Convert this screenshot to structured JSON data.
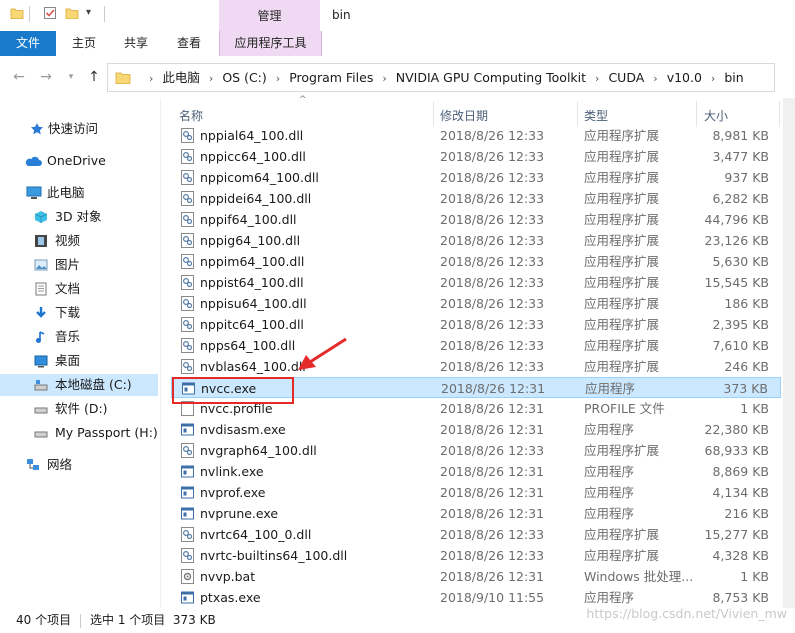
{
  "window": {
    "title": "bin",
    "context_tab_group": "管理"
  },
  "ribbon": {
    "tabs": [
      "文件",
      "主页",
      "共享",
      "查看"
    ],
    "context_tab": "应用程序工具",
    "accent": "#1979ca",
    "context_color": "#f0d9f3"
  },
  "address": {
    "crumbs": [
      "此电脑",
      "OS (C:)",
      "Program Files",
      "NVIDIA GPU Computing Toolkit",
      "CUDA",
      "v10.0",
      "bin"
    ]
  },
  "sidebar": {
    "items": [
      {
        "label": "快速访问",
        "icon": "star-icon"
      },
      {
        "label": "OneDrive",
        "icon": "cloud-icon"
      },
      {
        "label": "此电脑",
        "icon": "computer-icon"
      },
      {
        "label": "3D 对象",
        "icon": "cube-icon"
      },
      {
        "label": "视频",
        "icon": "video-icon"
      },
      {
        "label": "图片",
        "icon": "picture-icon"
      },
      {
        "label": "文档",
        "icon": "document-icon"
      },
      {
        "label": "下载",
        "icon": "download-icon"
      },
      {
        "label": "音乐",
        "icon": "music-icon"
      },
      {
        "label": "桌面",
        "icon": "desktop-icon"
      },
      {
        "label": "本地磁盘 (C:)",
        "icon": "drive-icon"
      },
      {
        "label": "软件 (D:)",
        "icon": "drive-icon"
      },
      {
        "label": "My Passport (H:)",
        "icon": "drive-icon"
      },
      {
        "label": "网络",
        "icon": "network-icon"
      }
    ]
  },
  "columns": {
    "name": "名称",
    "date": "修改日期",
    "type": "类型",
    "size": "大小"
  },
  "files": [
    {
      "name": "nppial64_100.dll",
      "date": "2018/8/26 12:33",
      "type": "应用程序扩展",
      "size": "8,981 KB",
      "kind": "dll"
    },
    {
      "name": "nppicc64_100.dll",
      "date": "2018/8/26 12:33",
      "type": "应用程序扩展",
      "size": "3,477 KB",
      "kind": "dll"
    },
    {
      "name": "nppicom64_100.dll",
      "date": "2018/8/26 12:33",
      "type": "应用程序扩展",
      "size": "937 KB",
      "kind": "dll"
    },
    {
      "name": "nppidei64_100.dll",
      "date": "2018/8/26 12:33",
      "type": "应用程序扩展",
      "size": "6,282 KB",
      "kind": "dll"
    },
    {
      "name": "nppif64_100.dll",
      "date": "2018/8/26 12:33",
      "type": "应用程序扩展",
      "size": "44,796 KB",
      "kind": "dll"
    },
    {
      "name": "nppig64_100.dll",
      "date": "2018/8/26 12:33",
      "type": "应用程序扩展",
      "size": "23,126 KB",
      "kind": "dll"
    },
    {
      "name": "nppim64_100.dll",
      "date": "2018/8/26 12:33",
      "type": "应用程序扩展",
      "size": "5,630 KB",
      "kind": "dll"
    },
    {
      "name": "nppist64_100.dll",
      "date": "2018/8/26 12:33",
      "type": "应用程序扩展",
      "size": "15,545 KB",
      "kind": "dll"
    },
    {
      "name": "nppisu64_100.dll",
      "date": "2018/8/26 12:33",
      "type": "应用程序扩展",
      "size": "186 KB",
      "kind": "dll"
    },
    {
      "name": "nppitc64_100.dll",
      "date": "2018/8/26 12:33",
      "type": "应用程序扩展",
      "size": "2,395 KB",
      "kind": "dll"
    },
    {
      "name": "npps64_100.dll",
      "date": "2018/8/26 12:33",
      "type": "应用程序扩展",
      "size": "7,610 KB",
      "kind": "dll"
    },
    {
      "name": "nvblas64_100.dll",
      "date": "2018/8/26 12:33",
      "type": "应用程序扩展",
      "size": "246 KB",
      "kind": "dll"
    },
    {
      "name": "nvcc.exe",
      "date": "2018/8/26 12:31",
      "type": "应用程序",
      "size": "373 KB",
      "kind": "exe",
      "selected": true
    },
    {
      "name": "nvcc.profile",
      "date": "2018/8/26 12:31",
      "type": "PROFILE 文件",
      "size": "1 KB",
      "kind": "file"
    },
    {
      "name": "nvdisasm.exe",
      "date": "2018/8/26 12:31",
      "type": "应用程序",
      "size": "22,380 KB",
      "kind": "exe"
    },
    {
      "name": "nvgraph64_100.dll",
      "date": "2018/8/26 12:33",
      "type": "应用程序扩展",
      "size": "68,933 KB",
      "kind": "dll"
    },
    {
      "name": "nvlink.exe",
      "date": "2018/8/26 12:31",
      "type": "应用程序",
      "size": "8,869 KB",
      "kind": "exe"
    },
    {
      "name": "nvprof.exe",
      "date": "2018/8/26 12:31",
      "type": "应用程序",
      "size": "4,134 KB",
      "kind": "exe"
    },
    {
      "name": "nvprune.exe",
      "date": "2018/8/26 12:31",
      "type": "应用程序",
      "size": "216 KB",
      "kind": "exe"
    },
    {
      "name": "nvrtc64_100_0.dll",
      "date": "2018/8/26 12:33",
      "type": "应用程序扩展",
      "size": "15,277 KB",
      "kind": "dll"
    },
    {
      "name": "nvrtc-builtins64_100.dll",
      "date": "2018/8/26 12:33",
      "type": "应用程序扩展",
      "size": "4,328 KB",
      "kind": "dll"
    },
    {
      "name": "nvvp.bat",
      "date": "2018/8/26 12:31",
      "type": "Windows 批处理...",
      "size": "1 KB",
      "kind": "bat"
    },
    {
      "name": "ptxas.exe",
      "date": "2018/9/10 11:55",
      "type": "应用程序",
      "size": "8,753 KB",
      "kind": "exe"
    }
  ],
  "status": {
    "item_count": "40 个项目",
    "selection": "选中 1 个项目  373 KB"
  },
  "watermark": "https://blog.csdn.net/Vivien_mw"
}
